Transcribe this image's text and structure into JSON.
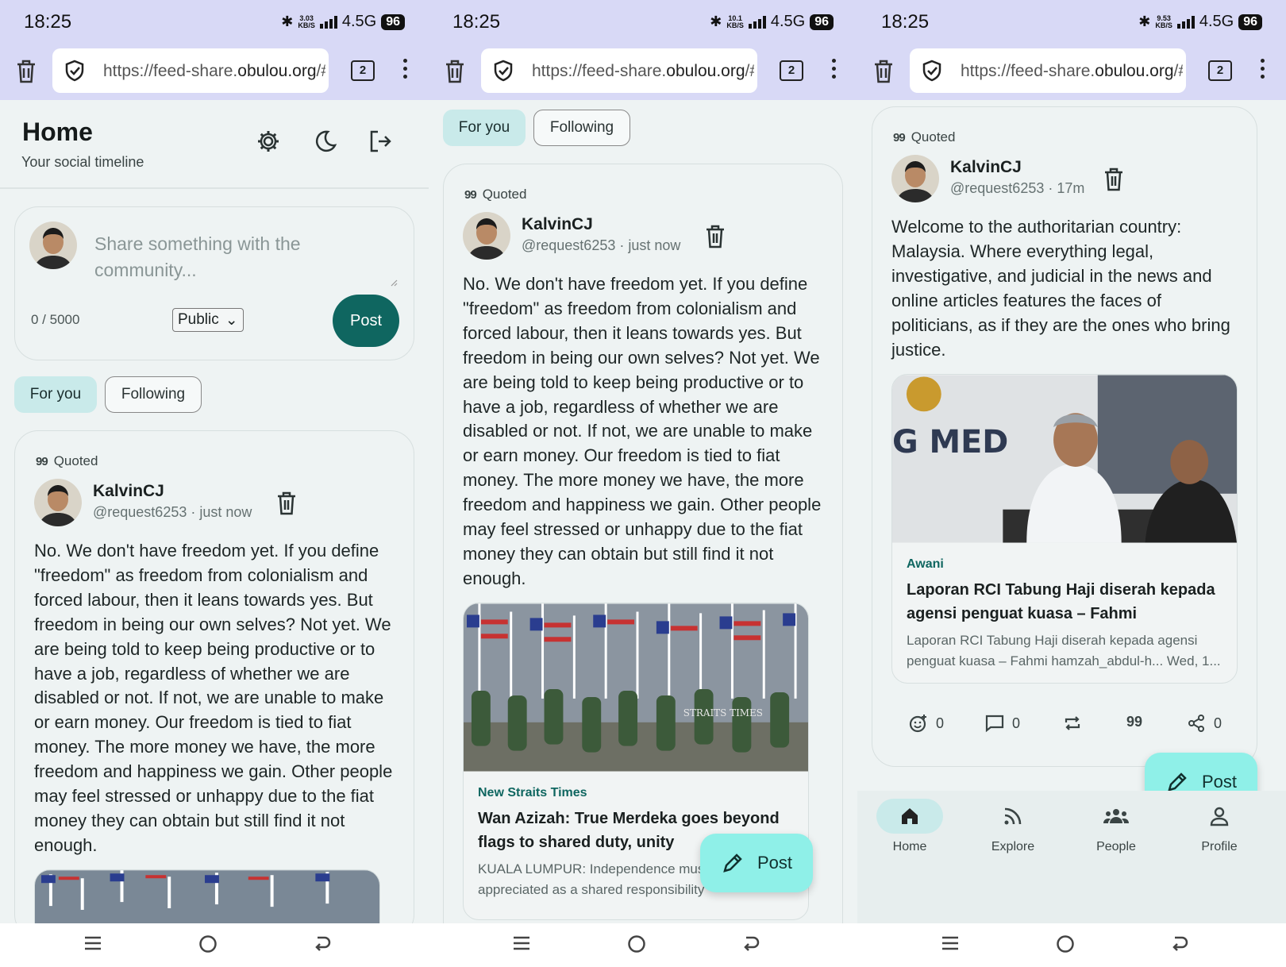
{
  "status_bar": {
    "time": "18:25",
    "network": "4.5G",
    "battery": "96",
    "speeds": [
      "3.03",
      "10.1",
      "9.53"
    ],
    "speed_unit": "KB/S"
  },
  "browser": {
    "url_prefix": "https://feed-share.",
    "url_domain": "obulou.org",
    "url_suffix": "/#",
    "tab_count": "2"
  },
  "header": {
    "title": "Home",
    "subtitle": "Your social timeline"
  },
  "composer": {
    "placeholder": "Share something with the community...",
    "char_count": "0 / 5000",
    "visibility": "Public",
    "post_label": "Post"
  },
  "tabs": {
    "for_you": "For you",
    "following": "Following"
  },
  "post1": {
    "quoted_label": "Quoted",
    "author": "KalvinCJ",
    "meta": "@request6253 · just now",
    "text": "No. We don't have freedom yet. If you define \"freedom\" as freedom from colonialism and forced labour, then it leans towards yes. But freedom in being our own selves? Not yet. We are being told to keep being productive or to have a job, regardless of whether we are disabled or not. If not, we are unable to make or earn money. Our freedom is tied to fiat money. The more money we have, the more freedom and happiness we gain. Other people may feel stressed or unhappy due to the fiat money they can obtain but still find it not enough.",
    "link": {
      "source": "New Straits Times",
      "title": "Wan Azizah: True Merdeka goes beyond flags to shared duty, unity",
      "description": "KUALA LUMPUR: Independence must be appreciated as a shared responsibility",
      "image_watermark": "STRAITS TIMES"
    }
  },
  "post2": {
    "quoted_label": "Quoted",
    "author": "KalvinCJ",
    "meta": "@request6253 · 17m",
    "text": "Welcome to the authoritarian country: Malaysia. Where everything legal, investigative, and judicial in the news and online articles features the faces of politicians, as if they are the ones who bring justice.",
    "link": {
      "source": "Awani",
      "title": "Laporan RCI Tabung Haji diserah kepada agensi penguat kuasa – Fahmi",
      "description": "Laporan RCI Tabung Haji diserah kepada agensi penguat kuasa – Fahmi hamzah_abdul-h... Wed, 1...",
      "image_banner_text": "G MED"
    },
    "actions": {
      "reactions": "0",
      "comments": "0",
      "quote_glyph": "99",
      "shares": "0"
    }
  },
  "fab": {
    "label": "Post"
  },
  "bottom_nav": {
    "home": "Home",
    "explore": "Explore",
    "people": "People",
    "profile": "Profile"
  },
  "colors": {
    "accent": "#0f6660",
    "chip_active": "#c9eaea",
    "fab": "#8ff0e8",
    "system_bar": "#d8d9f6"
  }
}
